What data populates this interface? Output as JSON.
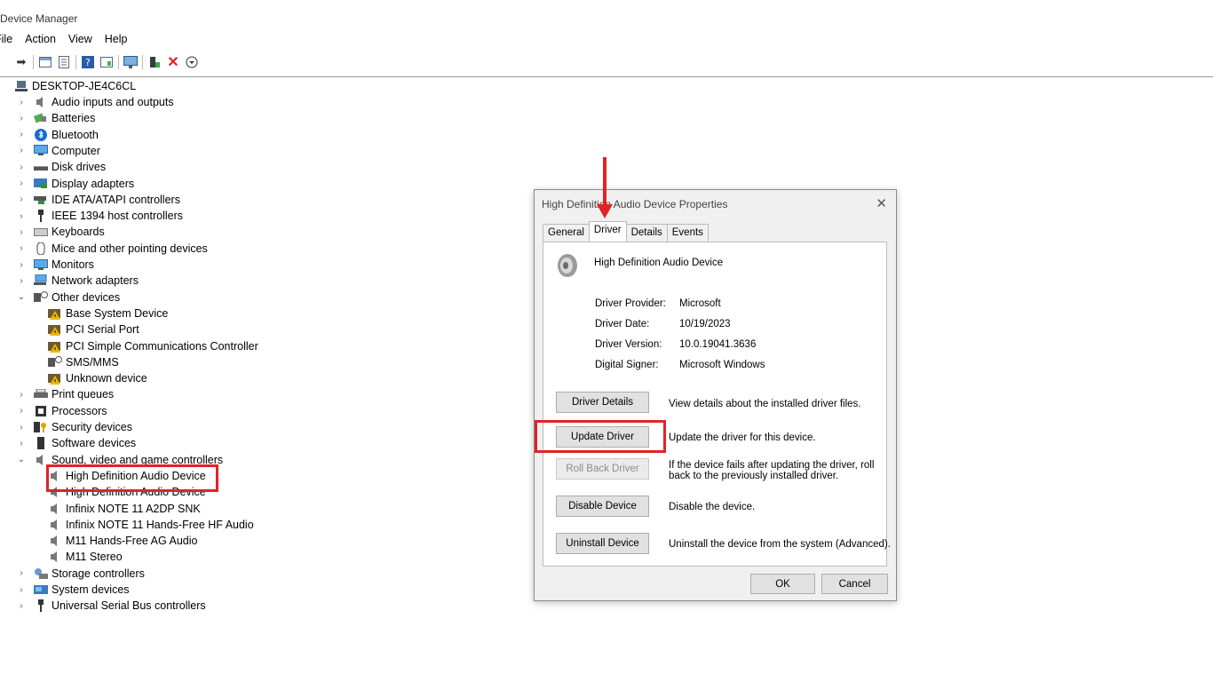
{
  "window": {
    "title": "Device Manager"
  },
  "menu": {
    "file": "File",
    "action": "Action",
    "view": "View",
    "help": "Help"
  },
  "toolbar": {
    "icons": [
      "back-arrow-icon",
      "show-hide-icon",
      "properties-icon",
      "help-icon",
      "action-view-icon",
      "monitor-icon",
      "update-driver-icon",
      "uninstall-icon",
      "download-icon"
    ],
    "uninstall_color": "#e02424"
  },
  "tree": {
    "root": "DESKTOP-JE4C6CL",
    "items": [
      {
        "label": "Audio inputs and outputs",
        "icon": "speaker-icon",
        "expander": "›"
      },
      {
        "label": "Batteries",
        "icon": "battery-icon",
        "expander": "›"
      },
      {
        "label": "Bluetooth",
        "icon": "bluetooth-icon",
        "expander": "›"
      },
      {
        "label": "Computer",
        "icon": "computer-icon",
        "expander": "›"
      },
      {
        "label": "Disk drives",
        "icon": "disk-icon",
        "expander": "›"
      },
      {
        "label": "Display adapters",
        "icon": "display-adapter-icon",
        "expander": "›"
      },
      {
        "label": "IDE ATA/ATAPI controllers",
        "icon": "ide-icon",
        "expander": "›"
      },
      {
        "label": "IEEE 1394 host controllers",
        "icon": "ieee-icon",
        "expander": "›"
      },
      {
        "label": "Keyboards",
        "icon": "keyboard-icon",
        "expander": "›"
      },
      {
        "label": "Mice and other pointing devices",
        "icon": "mouse-icon",
        "expander": "›"
      },
      {
        "label": "Monitors",
        "icon": "monitor-icon",
        "expander": "›"
      },
      {
        "label": "Network adapters",
        "icon": "network-icon",
        "expander": "›"
      },
      {
        "label": "Other devices",
        "icon": "unknown-device-icon",
        "expander": "⌄"
      },
      {
        "label": "Print queues",
        "icon": "printer-icon",
        "expander": "›"
      },
      {
        "label": "Processors",
        "icon": "processor-icon",
        "expander": "›"
      },
      {
        "label": "Security devices",
        "icon": "security-icon",
        "expander": "›"
      },
      {
        "label": "Software devices",
        "icon": "software-device-icon",
        "expander": "›"
      },
      {
        "label": "Sound, video and game controllers",
        "icon": "speaker-icon",
        "expander": "⌄"
      },
      {
        "label": "Storage controllers",
        "icon": "storage-icon",
        "expander": "›"
      },
      {
        "label": "System devices",
        "icon": "system-icon",
        "expander": "›"
      },
      {
        "label": "Universal Serial Bus controllers",
        "icon": "usb-icon",
        "expander": "›"
      }
    ],
    "other_devices": [
      {
        "label": "Base System Device",
        "icon": "warning-device-icon"
      },
      {
        "label": "PCI Serial Port",
        "icon": "warning-device-icon"
      },
      {
        "label": "PCI Simple Communications Controller",
        "icon": "warning-device-icon"
      },
      {
        "label": "SMS/MMS",
        "icon": "unknown-device-icon"
      },
      {
        "label": "Unknown device",
        "icon": "warning-device-icon"
      }
    ],
    "sound_devices": [
      {
        "label": "High Definition Audio Device"
      },
      {
        "label": "High Definition Audio Device"
      },
      {
        "label": "Infinix NOTE 11 A2DP SNK"
      },
      {
        "label": "Infinix NOTE 11 Hands-Free HF Audio"
      },
      {
        "label": "M11 Hands-Free AG Audio"
      },
      {
        "label": "M11 Stereo"
      }
    ]
  },
  "dialog": {
    "title": "High Definition Audio Device Properties",
    "close": "✕",
    "tabs": [
      "General",
      "Driver",
      "Details",
      "Events"
    ],
    "active_tab": "Driver",
    "device_name": "High Definition Audio Device",
    "info": [
      {
        "label": "Driver Provider:",
        "value": "Microsoft"
      },
      {
        "label": "Driver Date:",
        "value": "10/19/2023"
      },
      {
        "label": "Driver Version:",
        "value": "10.0.19041.3636"
      },
      {
        "label": "Digital Signer:",
        "value": "Microsoft Windows"
      }
    ],
    "buttons": [
      {
        "label": "Driver Details",
        "desc": "View details about the installed driver files.",
        "disabled": false
      },
      {
        "label": "Update Driver",
        "desc": "Update the driver for this device.",
        "disabled": false
      },
      {
        "label": "Roll Back Driver",
        "desc": "If the device fails after updating the driver, roll\nback to the previously installed driver.",
        "disabled": true
      },
      {
        "label": "Disable Device",
        "desc": "Disable the device.",
        "disabled": false
      },
      {
        "label": "Uninstall Device",
        "desc": "Uninstall the device from the system (Advanced).",
        "disabled": false
      }
    ],
    "ok": "OK",
    "cancel": "Cancel"
  },
  "annotations": {
    "highlight_color": "#e02424"
  }
}
